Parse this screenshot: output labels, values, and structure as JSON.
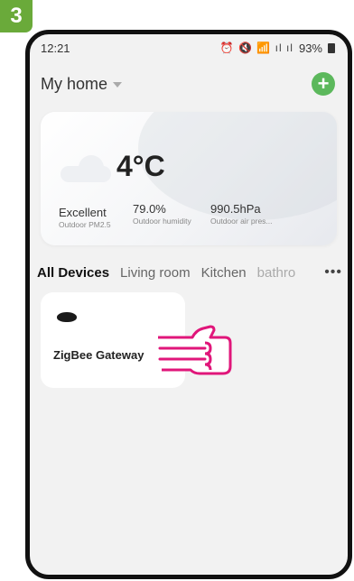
{
  "step_badge": "3",
  "status_bar": {
    "time": "12:21",
    "icons": "⏰ 🔇 📶 ıl ıl",
    "battery": "93%"
  },
  "header": {
    "title": "My home"
  },
  "weather": {
    "temperature": "4°C",
    "metrics": [
      {
        "value": "Excellent",
        "label": "Outdoor PM2.5"
      },
      {
        "value": "79.0%",
        "label": "Outdoor humidity"
      },
      {
        "value": "990.5hPa",
        "label": "Outdoor air pres..."
      }
    ]
  },
  "tabs": [
    "All Devices",
    "Living room",
    "Kitchen",
    "bathro"
  ],
  "device": {
    "name": "ZigBee Gateway"
  },
  "colors": {
    "accent_green": "#5cb85c",
    "badge_green": "#6aaa3a",
    "pointer_pink": "#e0167a"
  }
}
